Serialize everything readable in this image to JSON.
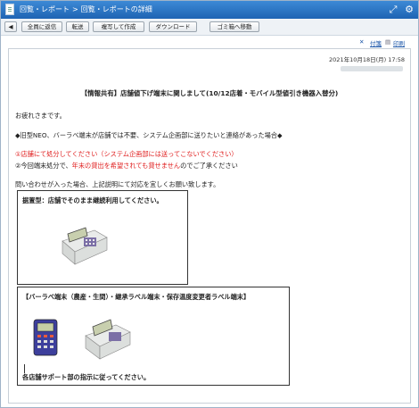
{
  "header": {
    "breadcrumb": [
      "回覧・レポート",
      "回覧・レポートの詳細"
    ],
    "separator": ">"
  },
  "toolbar": {
    "back_label": "",
    "reply_all_label": "全員に返信",
    "forward_label": "転送",
    "reuse_label": "複写して作成",
    "download_label": "ダウンロード",
    "trash_label": "ゴミ箱へ移動"
  },
  "controls": {
    "attachment_label": "付箋",
    "print_label": "印刷"
  },
  "message": {
    "date": "2021年10月18日(月) 17:58",
    "subject": "【情報共有】店舗値下げ端末に関しまして(10/12店着・モバイル型値引き機器入替分)",
    "greeting": "お疲れさまです。",
    "notice": "◆旧型NEO、バーラベ端末が店舗では不要、システム企画部に送りたいと連絡があった場合◆",
    "item1_a": "①店舗にて処分してください（",
    "item1_b": "システム企画部には送ってこないでください",
    "item1_c": "）",
    "item2_a": "②今回端末処分で、",
    "item2_b": "年末の貸出を希望されても貸せません",
    "item2_c": "のでご了承ください",
    "closing": "問い合わせが入った場合、上記説明にて対応を宜しくお願い致します。",
    "box1_title": "据置型：店舗でそのまま継続利用してください。",
    "box2_title": "【バーラベ端末（農産・生間）・継承ラベル端末・保存温度変更者ラベル端末】",
    "box2_footer": "各店舗サポート部の指示に従ってください。"
  },
  "colors": {
    "accent": "#1e63b3",
    "warning": "#e02020"
  }
}
